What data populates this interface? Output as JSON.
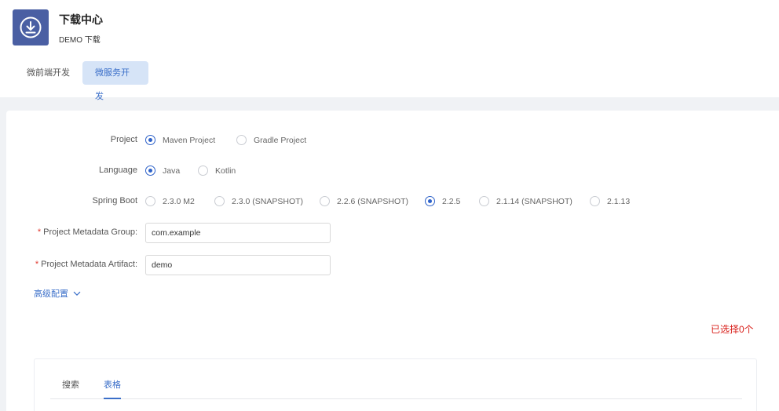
{
  "app": {
    "title": "下载中心",
    "subtitle": "DEMO 下载"
  },
  "tabs": [
    {
      "label": "微前端开发",
      "active": false
    },
    {
      "label": "微服务开发",
      "active": true
    }
  ],
  "form": {
    "project": {
      "label": "Project",
      "options": [
        "Maven Project",
        "Gradle Project"
      ],
      "selected": "Maven Project"
    },
    "language": {
      "label": "Language",
      "options": [
        "Java",
        "Kotlin"
      ],
      "selected": "Java"
    },
    "spring_boot": {
      "label": "Spring Boot",
      "options": [
        "2.3.0 M2",
        "2.3.0 (SNAPSHOT)",
        "2.2.6 (SNAPSHOT)",
        "2.2.5",
        "2.1.14 (SNAPSHOT)",
        "2.1.13"
      ],
      "selected": "2.2.5"
    },
    "group": {
      "label": "Project Metadata Group:",
      "required_mark": "*",
      "value": "com.example"
    },
    "artifact": {
      "label": "Project Metadata Artifact:",
      "required_mark": "*",
      "value": "demo"
    },
    "advanced_label": "高级配置"
  },
  "selected_count_text": "已选择0个",
  "inner_tabs": [
    {
      "label": "搜索",
      "active": false
    },
    {
      "label": "表格",
      "active": true
    }
  ],
  "colors": {
    "accent": "#3b6fc9",
    "app_icon_bg": "#4a5fa3",
    "active_tab_bg": "#d6e4f7",
    "required": "#e0352b",
    "count_text": "#d9201b"
  },
  "icons": {
    "app": "download-circle-icon",
    "expand": "chevron-down-icon"
  }
}
